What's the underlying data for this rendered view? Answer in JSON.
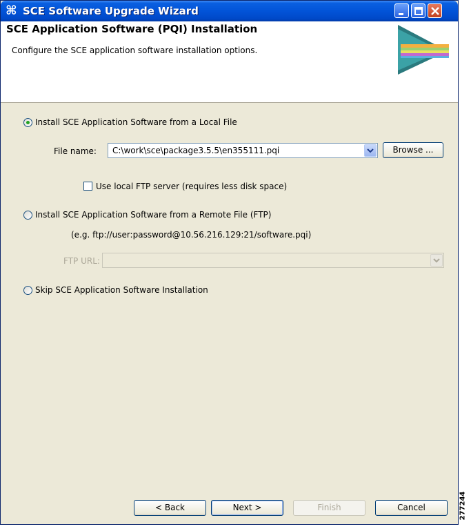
{
  "window": {
    "title": "SCE Software Upgrade Wizard",
    "icon": "cisco-bridge-icon"
  },
  "header": {
    "title": "SCE Application Software (PQI) Installation",
    "description": "Configure the SCE application software installation options."
  },
  "options": {
    "local_file": {
      "label": "Install SCE Application Software from a Local File",
      "selected": true,
      "file_name_label": "File name:",
      "file_name_value": "C:\\work\\sce\\package3.5.5\\en355111.pqi",
      "browse_label": "Browse ...",
      "use_local_ftp_label": "Use local FTP server (requires less disk space)",
      "use_local_ftp_checked": false
    },
    "remote_file": {
      "label": "Install SCE Application Software from a Remote File (FTP)",
      "selected": false,
      "example": "(e.g. ftp://user:password@10.56.216.129:21/software.pqi)",
      "ftp_url_label": "FTP URL:",
      "ftp_url_value": ""
    },
    "skip": {
      "label": "Skip SCE Application Software Installation",
      "selected": false
    }
  },
  "buttons": {
    "back": "< Back",
    "next": "Next >",
    "finish": "Finish",
    "cancel": "Cancel"
  },
  "watermark": "277244"
}
